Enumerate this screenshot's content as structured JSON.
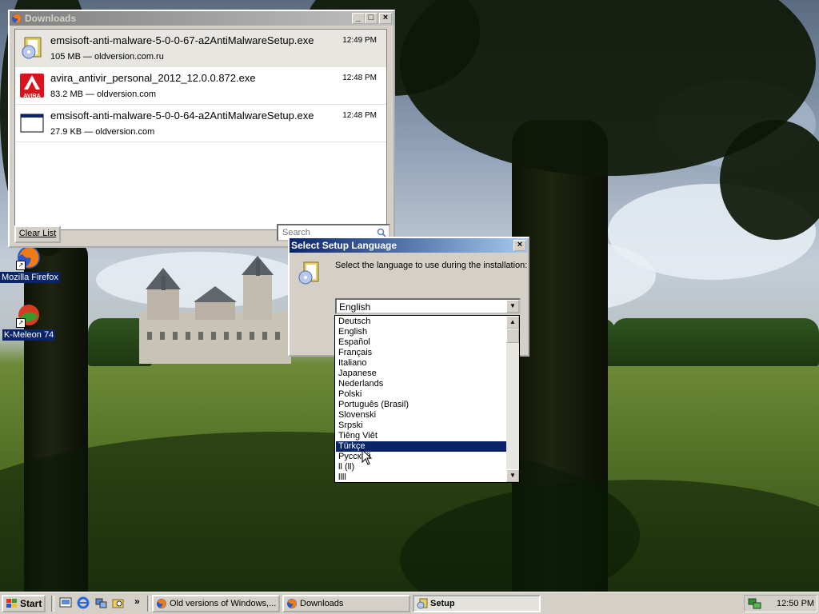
{
  "desktop": {
    "icons": [
      {
        "label": "Mozilla Firefox",
        "icon": "firefox-icon"
      },
      {
        "label": "K-Meleon 74",
        "icon": "kmeleon-icon"
      }
    ]
  },
  "downloads": {
    "title": "Downloads",
    "items": [
      {
        "name": "emsisoft-anti-malware-5-0-0-67-a2AntiMalwareSetup.exe",
        "meta": "105 MB — oldversion.com.ru",
        "time": "12:49 PM",
        "icon": "setup-package-icon"
      },
      {
        "name": "avira_antivir_personal_2012_12.0.0.872.exe",
        "meta": "83.2 MB — oldversion.com",
        "time": "12:48 PM",
        "icon": "avira-icon",
        "badge": "AVIRA"
      },
      {
        "name": "emsisoft-anti-malware-5-0-0-64-a2AntiMalwareSetup.exe",
        "meta": "27.9 KB — oldversion.com",
        "time": "12:48 PM",
        "icon": "window-file-icon"
      }
    ],
    "clear_label": "Clear List",
    "search_placeholder": "Search"
  },
  "setup": {
    "title": "Select Setup Language",
    "prompt": "Select the language to use during the installation:",
    "selected": "English",
    "options": [
      "Deutsch",
      "English",
      "Español",
      "Français",
      "Italiano",
      "Japanese",
      "Nederlands",
      "Polski",
      "Português (Brasil)",
      "Slovenski",
      "Srpski",
      "Tiêng Viêt",
      "Türkçe",
      "Русский",
      "ll (ll)",
      "llll"
    ],
    "highlighted": "Türkçe"
  },
  "taskbar": {
    "start_label": "Start",
    "tasks": [
      {
        "label": "Old versions of Windows,...",
        "icon": "firefox-icon"
      },
      {
        "label": "Downloads",
        "icon": "firefox-icon"
      },
      {
        "label": "Setup",
        "icon": "setup-icon",
        "active": true
      }
    ],
    "quicklaunch_more": "»",
    "clock": "12:50 PM"
  }
}
